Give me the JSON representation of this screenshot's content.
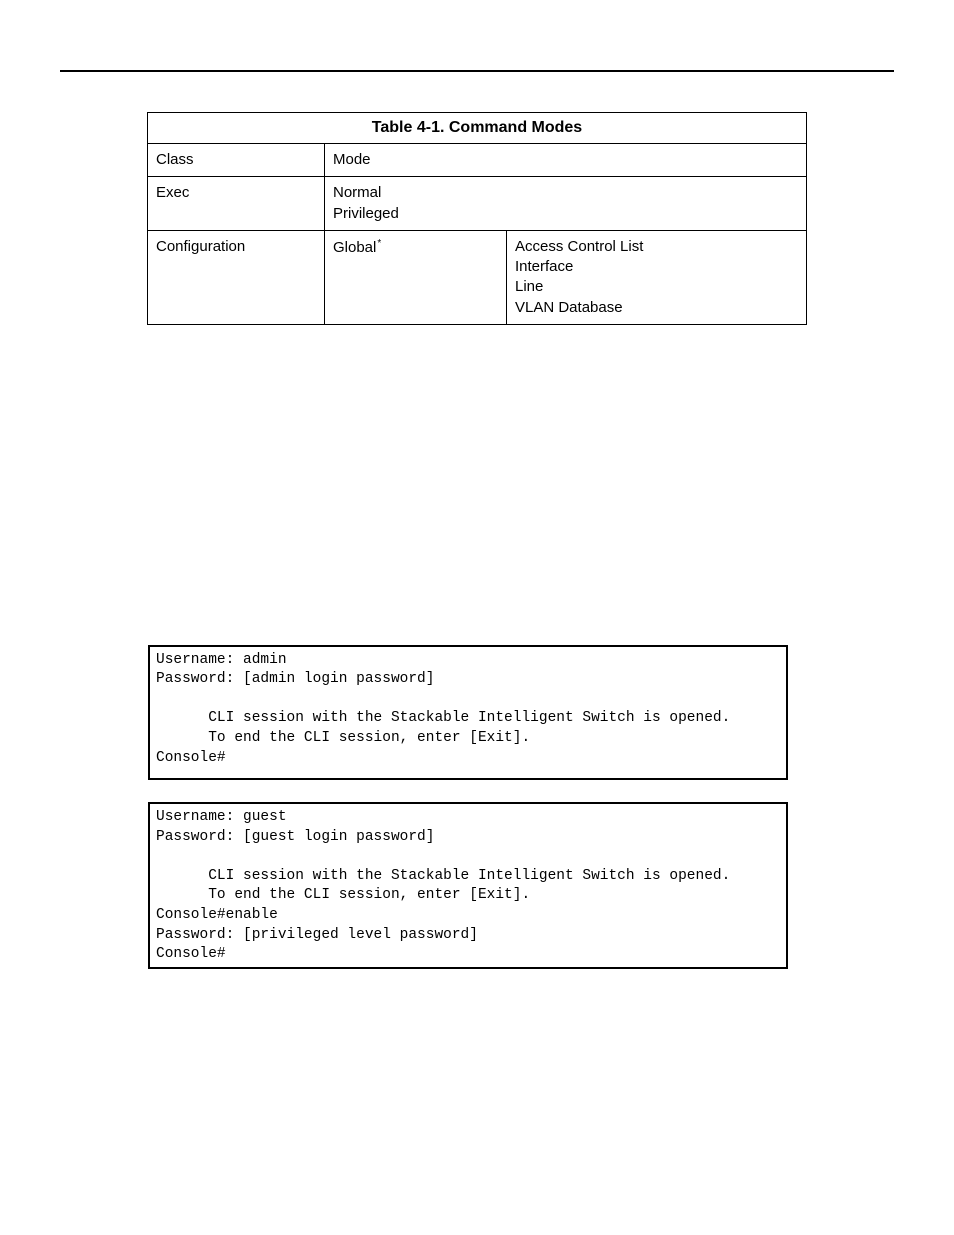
{
  "table": {
    "title": "Table 4-1.  Command Modes",
    "headers": {
      "class": "Class",
      "mode": "Mode"
    },
    "rows": [
      {
        "class": "Exec",
        "mode_lines": [
          "Normal",
          "Privileged"
        ],
        "sub_lines": []
      },
      {
        "class": "Configuration",
        "mode_lines": [
          "Global"
        ],
        "mode_suffix": "*",
        "sub_lines": [
          "Access Control List",
          "Interface",
          "Line",
          "VLAN Database"
        ]
      }
    ]
  },
  "console_blocks": [
    "Username: admin\nPassword: [admin login password]\n\n      CLI session with the Stackable Intelligent Switch is opened.\n      To end the CLI session, enter [Exit].\nConsole#",
    "Username: guest\nPassword: [guest login password]\n\n      CLI session with the Stackable Intelligent Switch is opened.\n      To end the CLI session, enter [Exit].\nConsole#enable\nPassword: [privileged level password]\nConsole#"
  ]
}
